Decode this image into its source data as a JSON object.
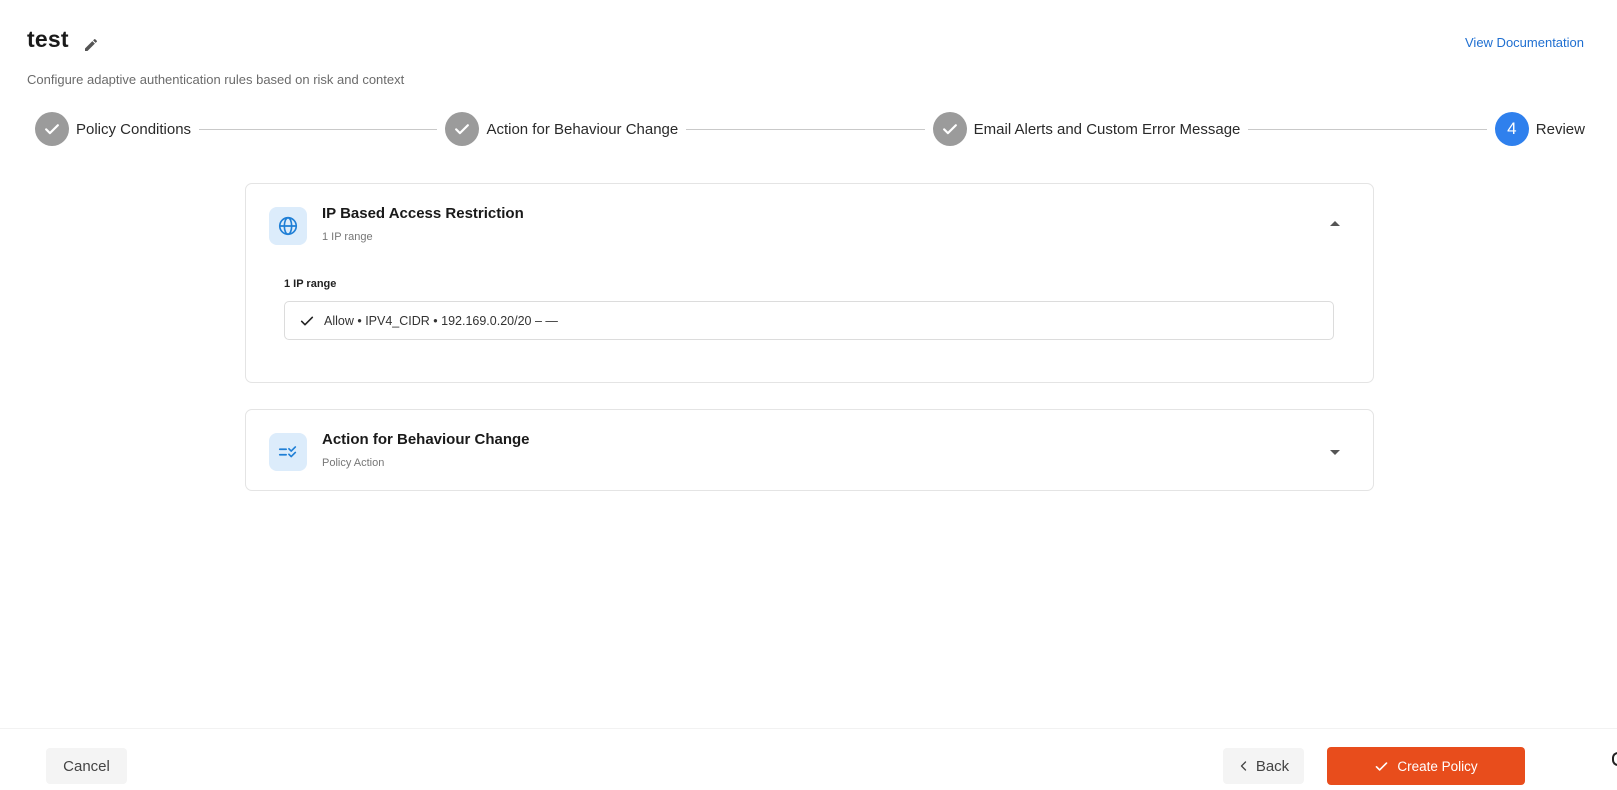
{
  "header": {
    "title": "test",
    "subtitle": "Configure adaptive authentication rules based on risk and context",
    "doc_link": "View Documentation"
  },
  "stepper": {
    "steps": [
      {
        "label": "Policy Conditions",
        "state": "done"
      },
      {
        "label": "Action for Behaviour Change",
        "state": "done"
      },
      {
        "label": "Email Alerts and Custom Error Message",
        "state": "done"
      },
      {
        "label": "Review",
        "state": "active",
        "number": "4"
      }
    ]
  },
  "cards": {
    "ip": {
      "title": "IP Based Access Restriction",
      "subtitle": "1 IP range",
      "icon": "globe-icon",
      "expanded": true,
      "section_label": "1 IP range",
      "entries": [
        {
          "text": "Allow • IPV4_CIDR • 192.169.0.20/20 – —"
        }
      ]
    },
    "action": {
      "title": "Action for Behaviour Change",
      "subtitle": "Policy Action",
      "icon": "checklist-icon",
      "expanded": false
    }
  },
  "footer": {
    "cancel_label": "Cancel",
    "back_label": "Back",
    "create_label": "Create Policy"
  },
  "colors": {
    "accent": "#2f80ed",
    "primary_button": "#e84d1c",
    "step_done": "#9b9b9b",
    "link": "#1f6fd1",
    "icon_bg": "#dcecfb"
  }
}
